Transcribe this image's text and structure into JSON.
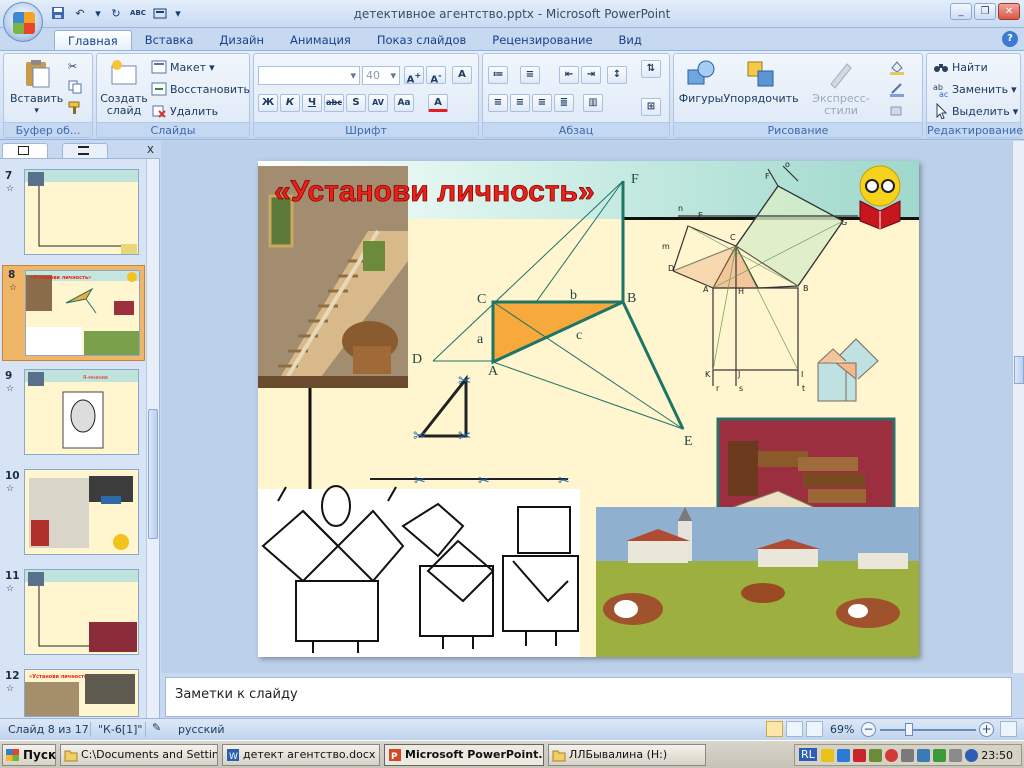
{
  "window": {
    "title": "детективное агентство.pptx - Microsoft PowerPoint"
  },
  "tabs": [
    "Главная",
    "Вставка",
    "Дизайн",
    "Анимация",
    "Показ слайдов",
    "Рецензирование",
    "Вид"
  ],
  "ribbon": {
    "clipboard": {
      "paste": "Вставить",
      "label": "Буфер об..."
    },
    "slides": {
      "new_slide": "Создать слайд",
      "layout": "Макет",
      "reset": "Восстановить",
      "delete": "Удалить",
      "label": "Слайды"
    },
    "font": {
      "size": "40",
      "label": "Шрифт"
    },
    "paragraph": {
      "label": "Абзац"
    },
    "drawing": {
      "shapes": "Фигуры",
      "arrange": "Упорядочить",
      "quick_styles": "Экспресс-стили",
      "label": "Рисование"
    },
    "editing": {
      "find": "Найти",
      "replace": "Заменить",
      "select": "Выделить",
      "label": "Редактирование"
    }
  },
  "slides_panel": {
    "thumbnails": [
      {
        "num": "7"
      },
      {
        "num": "8",
        "selected": true,
        "title": "«Установи личность»"
      },
      {
        "num": "9",
        "title": "Я-мнение"
      },
      {
        "num": "10"
      },
      {
        "num": "11"
      },
      {
        "num": "12",
        "title": "«Установи личность»"
      }
    ]
  },
  "slide": {
    "title": "«Установи личность»",
    "labels": {
      "F": "F",
      "C": "C",
      "b": "b",
      "B": "B",
      "a": "a",
      "c": "c",
      "D": "D",
      "A": "A",
      "E": "E"
    },
    "diagram_labels": {
      "o": "o",
      "F": "F",
      "n": "n",
      "E": "E",
      "C": "C",
      "G": "G",
      "m": "m",
      "D": "D",
      "A": "A",
      "H": "H",
      "B": "B",
      "K": "K",
      "J": "J",
      "I": "I",
      "r": "r",
      "s": "s",
      "t": "t"
    }
  },
  "notes": {
    "placeholder": "Заметки к слайду"
  },
  "statusbar": {
    "slide_info": "Слайд 8 из 17",
    "theme": "\"К-6[1]\"",
    "language": "русский",
    "zoom": "69%"
  },
  "taskbar": {
    "start": "Пуск",
    "tasks": [
      {
        "label": "C:\\Documents and Settin..."
      },
      {
        "label": "детект агентство.docx -..."
      },
      {
        "label": "Microsoft PowerPoint...",
        "active": true
      },
      {
        "label": "ЛЛБывалина (H:)"
      }
    ],
    "lang": "RL",
    "clock": "23:50"
  },
  "colors": {
    "ribbon": "#d4e2f4",
    "slide_bg": "#fff5cf",
    "title_red": "#e8221a",
    "geometry_teal": "#1d7565",
    "triangle_fill": "#f7a93c"
  }
}
